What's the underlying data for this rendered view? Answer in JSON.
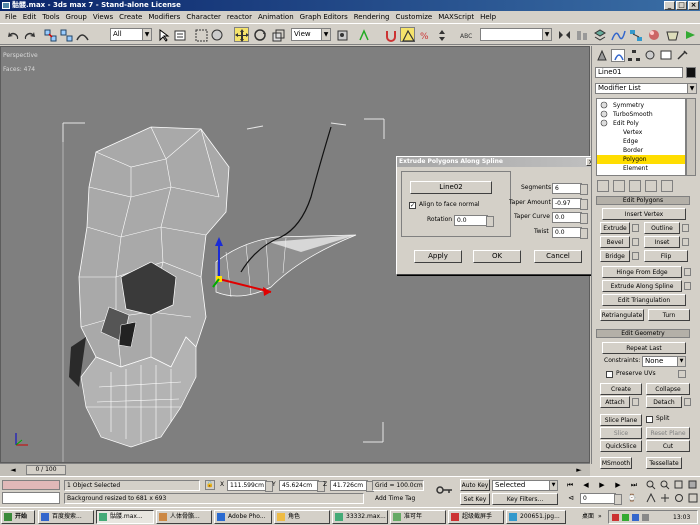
{
  "window": {
    "title": "骷髅.max - 3ds max 7 - Stand-alone License",
    "controls": {
      "minimize": "_",
      "maximize": "□",
      "close": "×"
    }
  },
  "menu": [
    "File",
    "Edit",
    "Tools",
    "Group",
    "Views",
    "Create",
    "Modifiers",
    "Character",
    "reactor",
    "Animation",
    "Graph Editors",
    "Rendering",
    "Customize",
    "MAXScript",
    "Help"
  ],
  "toolbar": {
    "selection_filter": "All",
    "ref_coord": "View"
  },
  "viewport": {
    "label": "Perspective",
    "stats": "Faces: 474"
  },
  "dialog": {
    "title": "Extrude Polygons Along Spline",
    "spline_button": "Line02",
    "align_label": "Align to face normal",
    "align_checked": true,
    "rotation_label": "Rotation",
    "rotation_value": "0.0",
    "segments_label": "Segments",
    "segments_value": "6",
    "taper_amount_label": "Taper Amount",
    "taper_amount_value": "-0.97",
    "taper_curve_label": "Taper Curve",
    "taper_curve_value": "0.0",
    "twist_label": "Twist",
    "twist_value": "0.0",
    "apply": "Apply",
    "ok": "OK",
    "cancel": "Cancel"
  },
  "command_panel": {
    "object_name": "Line01",
    "modifier_list": "Modifier List",
    "stack": [
      {
        "label": "Symmetry",
        "indent": 0,
        "selected": false
      },
      {
        "label": "TurboSmooth",
        "indent": 0,
        "selected": false
      },
      {
        "label": "Edit Poly",
        "indent": 0,
        "selected": false
      },
      {
        "label": "Vertex",
        "indent": 1,
        "selected": false
      },
      {
        "label": "Edge",
        "indent": 1,
        "selected": false
      },
      {
        "label": "Border",
        "indent": 1,
        "selected": false
      },
      {
        "label": "Polygon",
        "indent": 1,
        "selected": true
      },
      {
        "label": "Element",
        "indent": 1,
        "selected": false
      }
    ],
    "edit_polygons_header": "Edit Polygons",
    "insert_vertex": "Insert Vertex",
    "extrude": "Extrude",
    "outline": "Outline",
    "bevel": "Bevel",
    "inset": "Inset",
    "bridge": "Bridge",
    "flip": "Flip",
    "hinge_from_edge": "Hinge From Edge",
    "extrude_along_spline": "Extrude Along Spline",
    "edit_triangulation": "Edit Triangulation",
    "retriangulate": "Retriangulate",
    "turn": "Turn",
    "edit_geometry_header": "Edit Geometry",
    "repeat_last": "Repeat Last",
    "constraints_label": "Constraints:",
    "constraints_value": "None",
    "preserve_uvs": "Preserve UVs",
    "create": "Create",
    "collapse": "Collapse",
    "attach": "Attach",
    "detach": "Detach",
    "slice_plane": "Slice Plane",
    "split": "Split",
    "slice": "Slice",
    "reset_plane": "Reset Plane",
    "quickslice": "QuickSlice",
    "cut": "Cut",
    "msmooth": "MSmooth",
    "tessellate": "Tessellate"
  },
  "timeline": {
    "frame": "0 / 100"
  },
  "status": {
    "selection": "1 Object Selected",
    "prompt": "Background resized to 681 x 693",
    "x_label": "X",
    "x": "111.599cm",
    "y_label": "Y",
    "y": "45.624cm",
    "z_label": "Z",
    "z": "41.726cm",
    "grid": "Grid = 100.0cm",
    "add_time_tag": "Add Time Tag",
    "auto_key": "Auto Key",
    "auto_key_value": "Selected",
    "set_key": "Set Key",
    "key_filters": "Key Filters...",
    "frame_value": "0"
  },
  "taskbar": {
    "start": "开始",
    "tasks": [
      "百度搜索...",
      "骷髅.max...",
      "人体骨骼...",
      "Adobe Pho...",
      "角色",
      "33332.max...",
      "准可年",
      "超级截屏手",
      "200651.jpg..."
    ],
    "desktop": "桌面",
    "clock": "13:03"
  }
}
